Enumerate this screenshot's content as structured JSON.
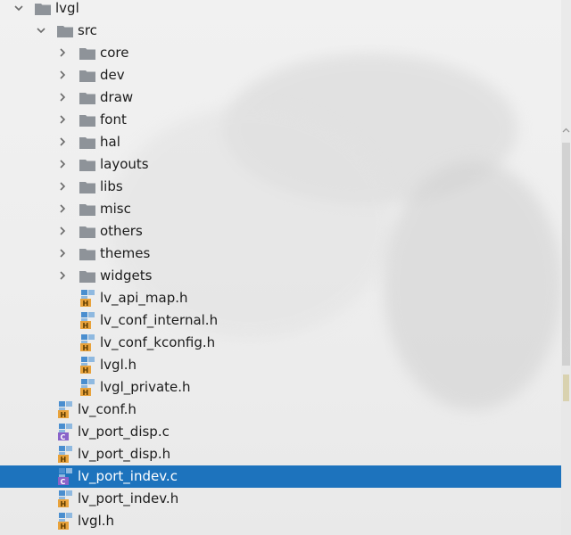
{
  "colors": {
    "selection": "#1d73bd",
    "folder": "#8e9399",
    "header_badge": "#e8a23b",
    "source_badge": "#8a63c9",
    "file_blue": "#4a8ecf"
  },
  "tree": {
    "root": {
      "label": "lvgl",
      "icon": "folder-icon",
      "expanded": true
    },
    "src": {
      "label": "src",
      "icon": "folder-icon",
      "expanded": true
    },
    "src_folders": [
      {
        "label": "core",
        "icon": "folder-icon"
      },
      {
        "label": "dev",
        "icon": "folder-icon"
      },
      {
        "label": "draw",
        "icon": "folder-icon"
      },
      {
        "label": "font",
        "icon": "folder-icon"
      },
      {
        "label": "hal",
        "icon": "folder-icon"
      },
      {
        "label": "layouts",
        "icon": "folder-icon"
      },
      {
        "label": "libs",
        "icon": "folder-icon"
      },
      {
        "label": "misc",
        "icon": "folder-icon"
      },
      {
        "label": "others",
        "icon": "folder-icon"
      },
      {
        "label": "themes",
        "icon": "folder-icon"
      },
      {
        "label": "widgets",
        "icon": "folder-icon"
      }
    ],
    "src_files": [
      {
        "label": "lv_api_map.h",
        "icon": "header-file-icon",
        "badge": "H"
      },
      {
        "label": "lv_conf_internal.h",
        "icon": "header-file-icon",
        "badge": "H"
      },
      {
        "label": "lv_conf_kconfig.h",
        "icon": "header-file-icon",
        "badge": "H"
      },
      {
        "label": "lvgl.h",
        "icon": "header-file-icon",
        "badge": "H"
      },
      {
        "label": "lvgl_private.h",
        "icon": "header-file-icon",
        "badge": "H"
      }
    ],
    "root_files": [
      {
        "label": "lv_conf.h",
        "icon": "header-file-icon",
        "badge": "H"
      },
      {
        "label": "lv_port_disp.c",
        "icon": "c-file-icon",
        "badge": "C"
      },
      {
        "label": "lv_port_disp.h",
        "icon": "header-file-icon",
        "badge": "H"
      },
      {
        "label": "lv_port_indev.c",
        "icon": "c-file-icon",
        "badge": "C",
        "selected": true
      },
      {
        "label": "lv_port_indev.h",
        "icon": "header-file-icon",
        "badge": "H"
      },
      {
        "label": "lvgl.h",
        "icon": "header-file-icon",
        "badge": "H"
      }
    ]
  }
}
